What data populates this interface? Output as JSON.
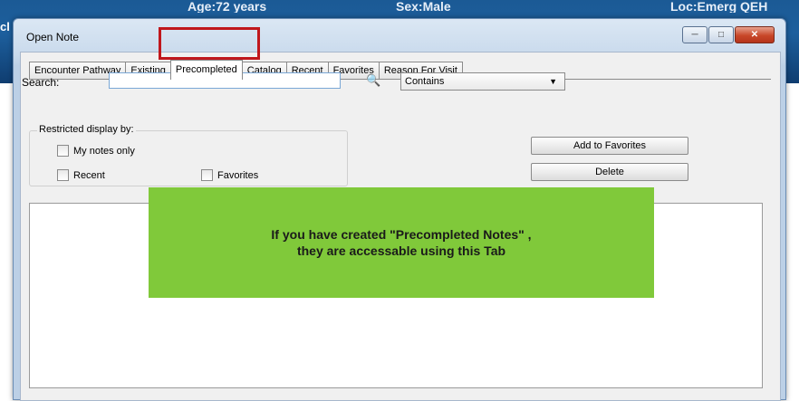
{
  "background": {
    "header_age": "Age:72 years",
    "header_sex": "Sex:Male",
    "header_loc": "Loc:Emerg QEH",
    "left_fragment": "cl"
  },
  "dialog": {
    "title": "Open Note",
    "tabs": [
      "Encounter Pathway",
      "Existing",
      "Precompleted",
      "Catalog",
      "Recent",
      "Favorites",
      "Reason For Visit"
    ],
    "active_tab": "Precompleted"
  },
  "search": {
    "label": "Search:",
    "value": "",
    "match_mode": "Contains"
  },
  "restricted": {
    "legend": "Restricted display by:",
    "my_notes_only": "My notes only",
    "recent": "Recent",
    "favorites": "Favorites"
  },
  "buttons": {
    "add_to_favorites": "Add to Favorites",
    "delete": "Delete"
  },
  "callout": {
    "line1": "If you have created \"Precompleted Notes\" ,",
    "line2": "they are accessable using this Tab"
  },
  "colors": {
    "highlight": "#c0171c",
    "callout_bg": "#80c93a",
    "header_blue": "#1d5f9d"
  }
}
